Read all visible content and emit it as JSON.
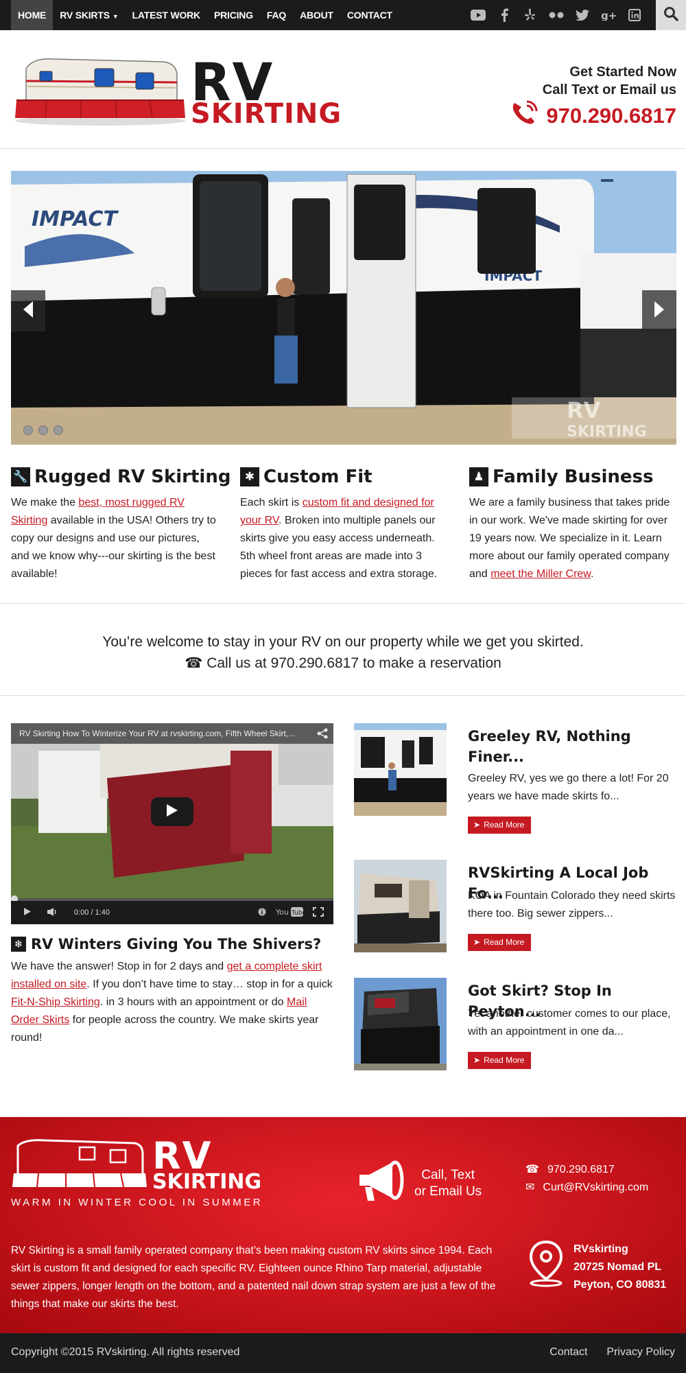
{
  "nav": {
    "items": [
      {
        "label": "HOME",
        "active": true
      },
      {
        "label": "RV SKIRTS",
        "dropdown": true
      },
      {
        "label": "LATEST WORK"
      },
      {
        "label": "PRICING"
      },
      {
        "label": "FAQ"
      },
      {
        "label": "ABOUT"
      },
      {
        "label": "CONTACT"
      }
    ],
    "social_icons": [
      "youtube-icon",
      "facebook-icon",
      "yelp-icon",
      "flickr-icon",
      "twitter-icon",
      "google-plus-icon",
      "linkedin-icon"
    ],
    "search_icon": "search-icon"
  },
  "header": {
    "logo_line1": "RV",
    "logo_line2": "SKIRTING",
    "cta_line1": "Get Started Now",
    "cta_line2": "Call Text or Email us",
    "phone": "970.290.6817"
  },
  "slider": {
    "brand_text": "IMPACT",
    "watermark_line1": "RV",
    "watermark_line2": "SKIRTING",
    "slide_count": 3,
    "active_slide": 1
  },
  "features": [
    {
      "icon": "wrench-icon",
      "title": "Rugged RV Skirting",
      "pre": "We make the ",
      "link": "best, most rugged RV Skirting",
      "post": " available in the USA! Others try to copy our designs and use our pictures, and we know why---our skirting is the best available!"
    },
    {
      "icon": "puzzle-icon",
      "title": "Custom Fit",
      "pre": "Each skirt is ",
      "link": "custom fit and designed for your RV",
      "post": ". Broken into multiple panels our skirts give you easy access underneath. 5th wheel front areas are made into 3 pieces for fast access and extra storage."
    },
    {
      "icon": "family-icon",
      "title": "Family Business",
      "pre": "We are a family business that takes pride in our work. We've made skirting for over 19 years now. We specialize in it. Learn more about our family operated company and ",
      "link": "meet the Miller Crew",
      "post": "."
    }
  ],
  "welcome": {
    "line1": "You’re welcome to stay in your RV on our property while we get you skirted.",
    "line2": "Call us at 970.290.6817 to make a reservation"
  },
  "video": {
    "title": "RV Skirting How To Winterize Your RV at rvskirting.com, Fifth Wheel Skirt,...",
    "time": "0:00 / 1:40"
  },
  "winter": {
    "title": "RV Winters Giving You The Shivers?",
    "t1": "We have the answer! Stop in for 2 days and ",
    "l1": "get a complete skirt installed on site",
    "t2": ". If you don’t have time to stay… stop in for a quick ",
    "l2": "Fit-N-Ship Skirting",
    "t3": ". in 3 hours with an appointment or do ",
    "l3": "Mail Order Skirts",
    "t4": " for people across the country. We make skirts year round!"
  },
  "posts": [
    {
      "title": "Greeley RV, Nothing Finer...",
      "excerpt": "Greeley RV, yes we go there a lot! For 20 years we have made skirts fo...",
      "button": "Read More"
    },
    {
      "title": "RVSkirting A Local Job Fo...",
      "excerpt": "KOA in Fountain Colorado they need skirts there too. Big sewer zippers...",
      "button": "Read More"
    },
    {
      "title": "Got Skirt? Stop In Peyton...",
      "excerpt": "Yet another customer comes to our place, with an appointment in one da...",
      "button": "Read More"
    }
  ],
  "footer": {
    "logo_line1": "RV",
    "logo_line2": "SKIRTING",
    "tagline": "WARM IN WINTER COOL IN SUMMER",
    "call_line1": "Call, Text",
    "call_line2": "or Email Us",
    "phone": "970.290.6817",
    "email": "Curt@RVskirting.com",
    "about": "RV Skirting is a small family operated company that’s been making custom RV skirts since 1994. Each skirt is custom fit and designed for each specific RV. Eighteen ounce Rhino Tarp material, adjustable sewer zippers, longer length on the bottom, and a patented nail down strap system are just a few of the things that make our skirts the best.",
    "address_name": "RVskirting",
    "address_street": "20725 Nomad PL",
    "address_city": "Peyton, CO 80831"
  },
  "bottom": {
    "copyright": "Copyright ©2015 RVskirting. All rights reserved",
    "links": [
      "Contact",
      "Privacy Policy"
    ]
  },
  "colors": {
    "brand_red": "#c51a22",
    "nav_bg": "#1b1b1b",
    "footer_red": "#d21a21"
  }
}
